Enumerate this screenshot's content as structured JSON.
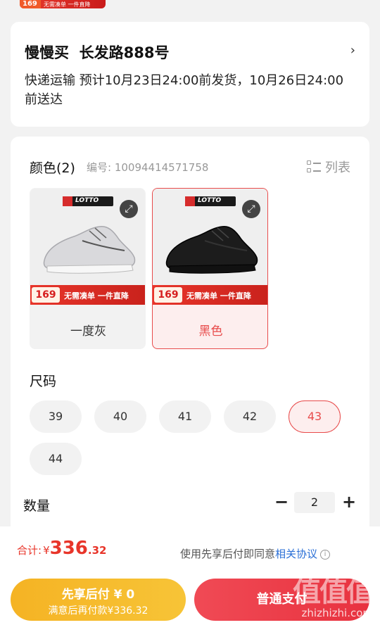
{
  "promo_strip": {
    "price": "169",
    "text": "无需凑单 一件直降"
  },
  "address": {
    "name": "慢慢买",
    "street": "长发路888号",
    "delivery": "快递运输 预计10月23日24:00前发货，10月26日24:00前送达"
  },
  "color": {
    "title": "颜色(2)",
    "code": "编号: 10094414571758",
    "list_label": "列表",
    "options": [
      {
        "label": "一度灰",
        "price": "169",
        "promo": "无需凑单 一件直降",
        "logo": "LOTTO",
        "selected": false
      },
      {
        "label": "黑色",
        "price": "169",
        "promo": "无需凑单 一件直降",
        "logo": "LOTTO",
        "selected": true
      }
    ]
  },
  "size": {
    "title": "尺码",
    "options": [
      "39",
      "40",
      "41",
      "42",
      "43",
      "44"
    ],
    "selected": "43"
  },
  "quantity": {
    "title": "数量",
    "minus": "−",
    "value": "2",
    "plus": "+"
  },
  "footer": {
    "total_label": "合计:",
    "currency": "¥",
    "total_int": "336",
    "total_dec": ".32",
    "agree_text": "使用先享后付即同意",
    "agree_link": "相关协议",
    "credit_btn_line1": "先享后付 ¥ 0",
    "credit_btn_line2": "满意后再付款¥336.32",
    "pay_btn": "普通支付"
  },
  "watermark": {
    "logo": "值值值",
    "domain": "zhizhizhi.com"
  },
  "colors": {
    "accent": "#e84b4b",
    "price_red": "#e8352a",
    "credit_yellow": "#f5b324",
    "pay_red": "#e8323f",
    "link_blue": "#2a6fd6"
  }
}
